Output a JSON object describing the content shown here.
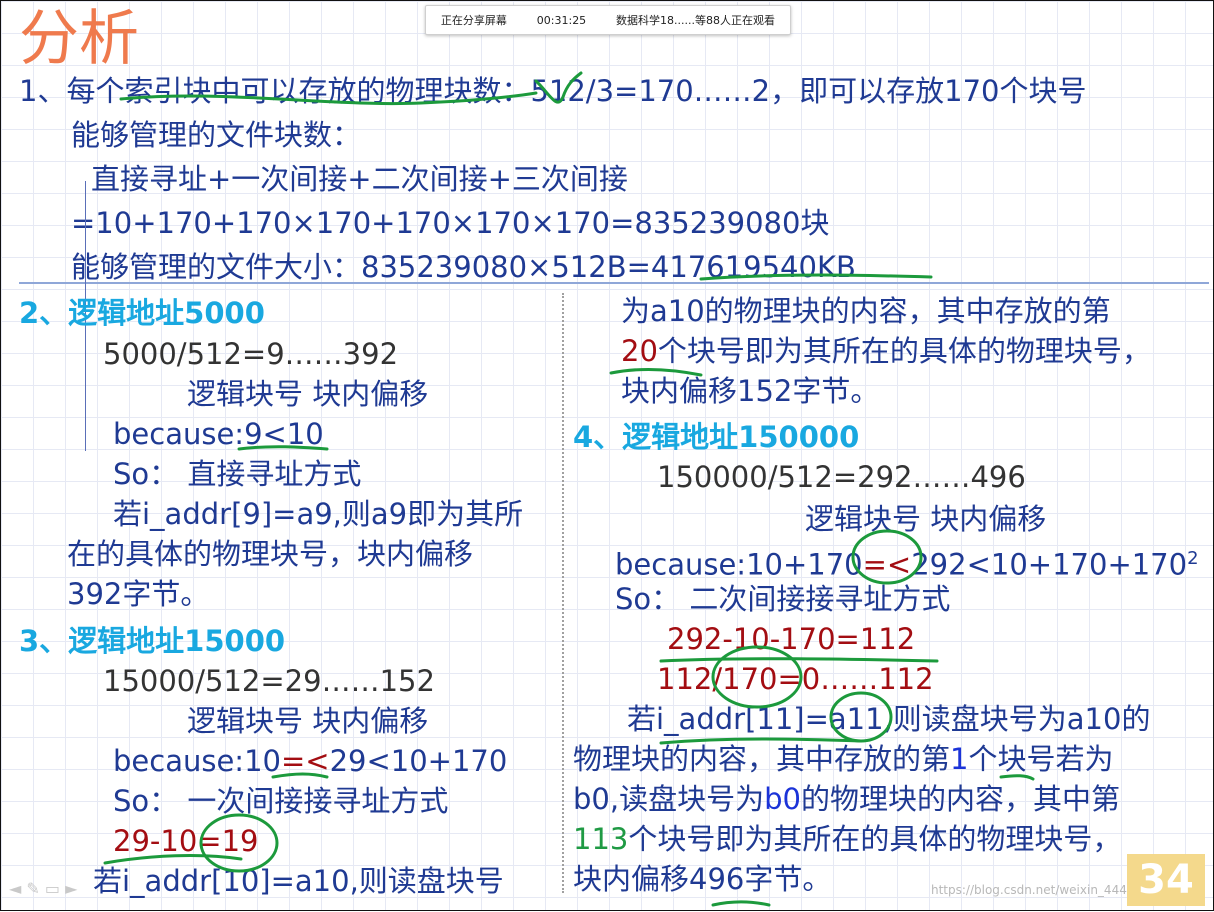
{
  "share_bar": {
    "status": "正在分享屏幕",
    "timer": "00:31:25",
    "viewers": "数据科学18......等88人正在观看"
  },
  "slide": {
    "title": "分析",
    "p1": {
      "line1": "1、每个索引块中可以存放的物理块数：512/3=170……2，即可以存放170个块号",
      "line2": "能够管理的文件块数：",
      "line3": "直接寻址+一次间接+二次间接+三次间接",
      "line4": "=10+170+170×170+170×170×170=835239080块",
      "line5": "能够管理的文件大小：835239080×512B=417619540KB"
    },
    "p2": {
      "heading": "2、逻辑地址5000",
      "calc": "5000/512=9……392",
      "labels": "逻辑块号  块内偏移",
      "because": "because:9<10",
      "so": "So： 直接寻址方式",
      "line1": "若i_addr[9]=a9,则a9即为其所",
      "line2": "在的具体的物理块号，块内偏移",
      "line3": "392字节。"
    },
    "p3": {
      "heading": "3、逻辑地址15000",
      "calc": "15000/512=29……152",
      "labels": "逻辑块号  块内偏移",
      "because_a": "because:10",
      "because_b": "=<",
      "because_c": "29<10+170",
      "so": "So： 一次间接接寻址方式",
      "red_calc": "29-10=19",
      "line1": "若i_addr[10]=a10,则读盘块号"
    },
    "col2_top": {
      "line1": "为a10的物理块的内容，其中存放的第",
      "line2_red": "20",
      "line2_rest": "个块号即为其所在的具体的物理块号，",
      "line3": "块内偏移152字节。"
    },
    "p4": {
      "heading": "4、逻辑地址150000",
      "calc": "150000/512=292……496",
      "labels": "逻辑块号  块内偏移",
      "because_a": "because:10+170",
      "because_b": "=<",
      "because_c": "292<10+170+170",
      "because_sup": "2",
      "so": "So： 二次间接接寻址方式",
      "red1": "292-10-170=112",
      "red2": "112/170=0……112",
      "line1": "若i_addr[11]=a11,则读盘块号为a10的",
      "line2_a": "物理块的内容，其中存放的第",
      "line2_blue": "1",
      "line2_b": "个块号若为",
      "line3_a": "b0,读盘块号为",
      "line3_blue": "b0",
      "line3_b": "的物理块的内容，其中第",
      "line4_green": "113",
      "line4_rest": "个块号即为其所在的具体的物理块号，",
      "line5": "块内偏移496字节。"
    },
    "page_number": "34",
    "watermark": "https://blog.csdn.net/weixin_44409365",
    "nav_controls": "◄ ✎ ▭ ►"
  },
  "colors": {
    "title": "#ef7a4d",
    "heading": "#19a8e0",
    "body": "#1f3a93",
    "red": "#a30d12",
    "blue": "#1b33d8",
    "green": "#1f9a44",
    "ink": "#1c9a3c",
    "badge": "#f4d98c"
  }
}
